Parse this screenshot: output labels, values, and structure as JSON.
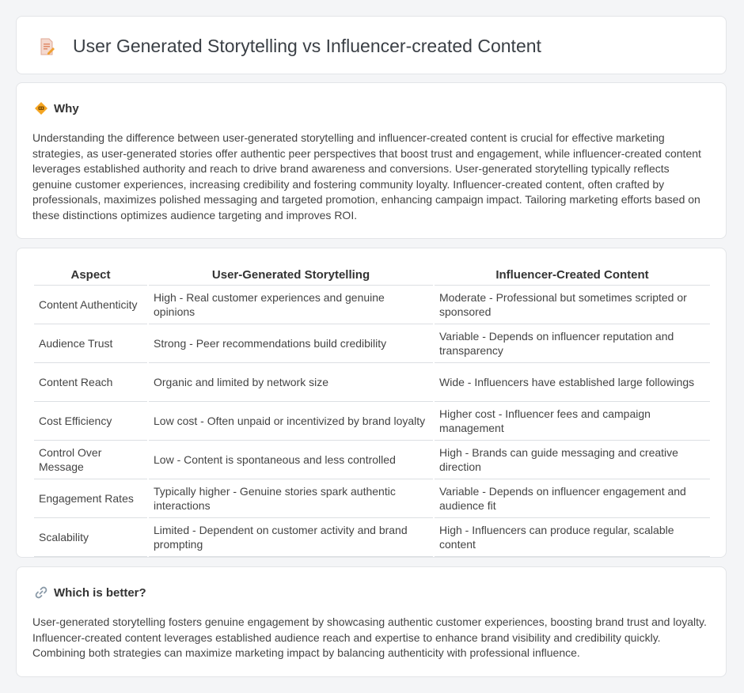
{
  "header": {
    "title": "User Generated Storytelling vs Influencer-created Content",
    "icon": "document-edit-icon"
  },
  "why": {
    "heading": "Why",
    "icon": "diamond-warning-icon",
    "text": "Understanding the difference between user-generated storytelling and influencer-created content is crucial for effective marketing strategies, as user-generated stories offer authentic peer perspectives that boost trust and engagement, while influencer-created content leverages established authority and reach to drive brand awareness and conversions. User-generated storytelling typically reflects genuine customer experiences, increasing credibility and fostering community loyalty. Influencer-created content, often crafted by professionals, maximizes polished messaging and targeted promotion, enhancing campaign impact. Tailoring marketing efforts based on these distinctions optimizes audience targeting and improves ROI."
  },
  "table": {
    "headers": [
      "Aspect",
      "User-Generated Storytelling",
      "Influencer-Created Content"
    ],
    "rows": [
      [
        "Content Authenticity",
        "High - Real customer experiences and genuine opinions",
        "Moderate - Professional but sometimes scripted or sponsored"
      ],
      [
        "Audience Trust",
        "Strong - Peer recommendations build credibility",
        "Variable - Depends on influencer reputation and transparency"
      ],
      [
        "Content Reach",
        "Organic and limited by network size",
        "Wide - Influencers have established large followings"
      ],
      [
        "Cost Efficiency",
        "Low cost - Often unpaid or incentivized by brand loyalty",
        "Higher cost - Influencer fees and campaign management"
      ],
      [
        "Control Over Message",
        "Low - Content is spontaneous and less controlled",
        "High - Brands can guide messaging and creative direction"
      ],
      [
        "Engagement Rates",
        "Typically higher - Genuine stories spark authentic interactions",
        "Variable - Depends on influencer engagement and audience fit"
      ],
      [
        "Scalability",
        "Limited - Dependent on customer activity and brand prompting",
        "High - Influencers can produce regular, scalable content"
      ]
    ]
  },
  "which": {
    "heading": "Which is better?",
    "icon": "link-icon",
    "text": "User-generated storytelling fosters genuine engagement by showcasing authentic customer experiences, boosting brand trust and loyalty. Influencer-created content leverages established audience reach and expertise to enhance brand visibility and credibility quickly. Combining both strategies can maximize marketing impact by balancing authenticity with professional influence."
  }
}
